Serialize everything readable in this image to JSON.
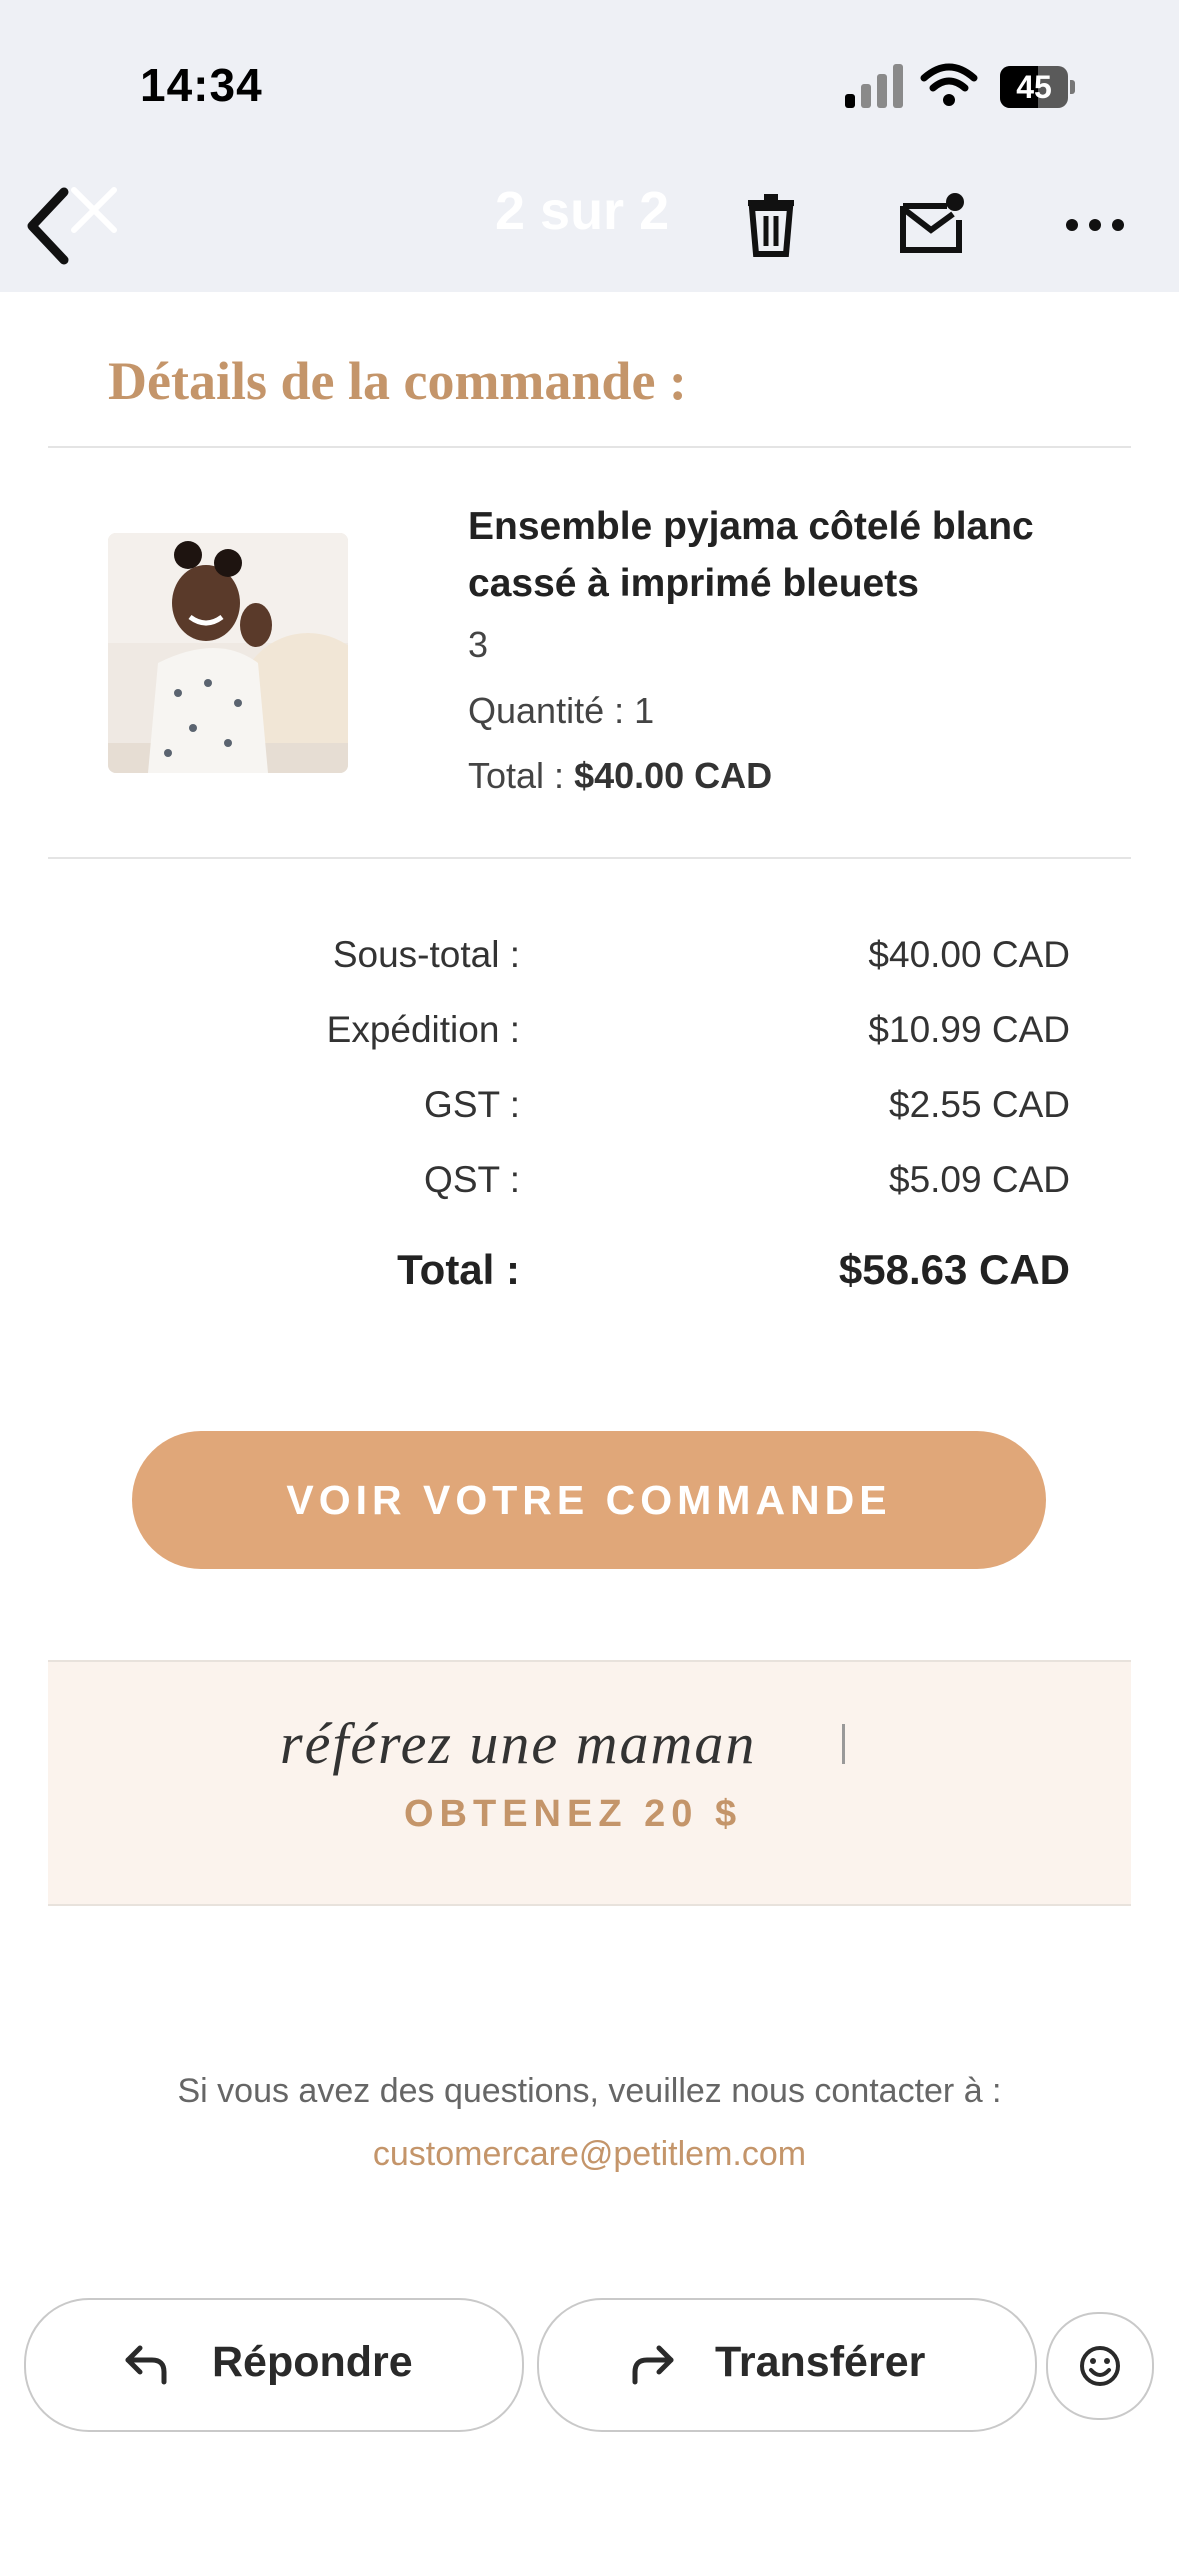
{
  "status_bar": {
    "time": "14:34",
    "battery": "45"
  },
  "nav": {
    "counter": "2 sur 2"
  },
  "email": {
    "heading": "Détails de la commande :",
    "product": {
      "name": "Ensemble pyjama côtelé blanc cassé à imprimé bleuets",
      "size": "3",
      "quantity": "Quantité : 1",
      "total_label": "Total :",
      "total_value": "$40.00 CAD"
    },
    "summary": [
      {
        "label": "Sous-total :",
        "value": "$40.00 CAD"
      },
      {
        "label": "Expédition :",
        "value": "$10.99 CAD"
      },
      {
        "label": "GST :",
        "value": "$2.55 CAD"
      },
      {
        "label": "QST :",
        "value": "$5.09 CAD"
      }
    ],
    "grand_total": {
      "label": "Total :",
      "value": "$58.63 CAD"
    },
    "cta": "VOIR VOTRE COMMANDE",
    "referral": {
      "script": "référez une maman",
      "offer": "OBTENEZ 20 $"
    },
    "contact": "Si vous avez des questions, veuillez nous contacter à :",
    "contact_email": "customercare@petitlem.com"
  },
  "actions": {
    "reply": "Répondre",
    "forward": "Transférer"
  },
  "colors": {
    "accent": "#c4956a",
    "cta": "#e0a779",
    "referral_bg": "#fbf3ed"
  }
}
